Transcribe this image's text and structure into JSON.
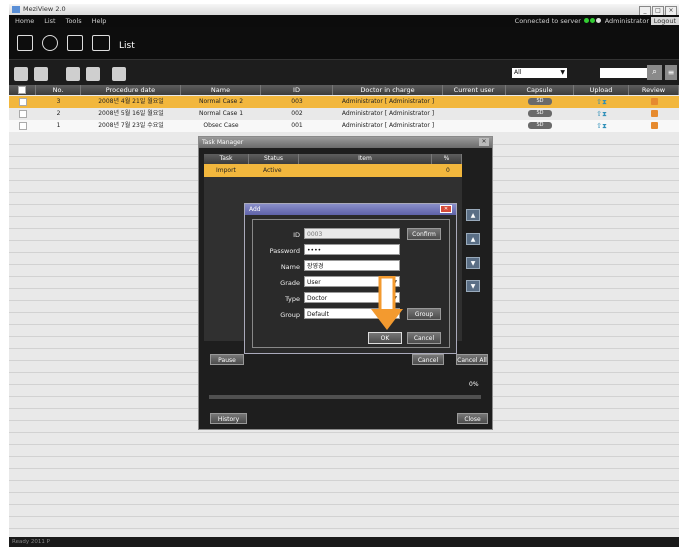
{
  "window": {
    "title": "MeziView 2.0",
    "buttons": [
      "_",
      "□",
      "×"
    ]
  },
  "menubar": {
    "items": [
      "Home",
      "List",
      "Tools",
      "Help"
    ],
    "connection_text": "Connected to server",
    "user_text": "Administrator",
    "logout_label": "Logout"
  },
  "toolbar": {
    "title": "List"
  },
  "filter": {
    "selected": "All"
  },
  "table": {
    "columns": [
      "No.",
      "Procedure date",
      "Name",
      "ID",
      "Doctor in charge",
      "Current user",
      "Capsule",
      "Upload",
      "Review"
    ],
    "rows": [
      {
        "no": "3",
        "date": "2008년 4월 21일 월요일",
        "name": "Normal Case 2",
        "id": "003",
        "doctor": "Administrator [ Administrator ]",
        "capsule": "SD",
        "selected": true
      },
      {
        "no": "2",
        "date": "2008년 5월 16일 월요일",
        "name": "Normal Case 1",
        "id": "002",
        "doctor": "Administrator [ Administrator ]",
        "capsule": "SD",
        "selected": false
      },
      {
        "no": "1",
        "date": "2008년 7월 23일 수요일",
        "name": "Obsec Case",
        "id": "001",
        "doctor": "Administrator [ Administrator ]",
        "capsule": "SD",
        "selected": false
      }
    ]
  },
  "status_bar": {
    "left": "Ready  2011 P"
  },
  "task_manager": {
    "title": "Task Manager",
    "columns": [
      "Task",
      "Status",
      "Item",
      "%"
    ],
    "row": {
      "task": "Import",
      "status": "Active",
      "item": "",
      "pct": "0"
    },
    "buttons": {
      "pause": "Pause",
      "cancel": "Cancel",
      "cancel_all": "Cancel All",
      "history": "History",
      "close": "Close"
    },
    "progress_label": "0%",
    "progress_value": 0
  },
  "add_dialog": {
    "title": "Add",
    "labels": {
      "id": "ID",
      "password": "Password",
      "name": "Name",
      "grade": "Grade",
      "type": "Type",
      "group": "Group"
    },
    "values": {
      "id": "0003",
      "password": "••••",
      "name": "장영경",
      "grade": "User",
      "type": "Doctor",
      "group": "Default"
    },
    "confirm_label": "Confirm",
    "group_button": "Group",
    "ok_label": "OK",
    "cancel_label": "Cancel"
  },
  "colors": {
    "selected_row": "#f2b73d",
    "pointer_arrow": "#f39a2f",
    "accent_blue": "#5e62a8"
  }
}
